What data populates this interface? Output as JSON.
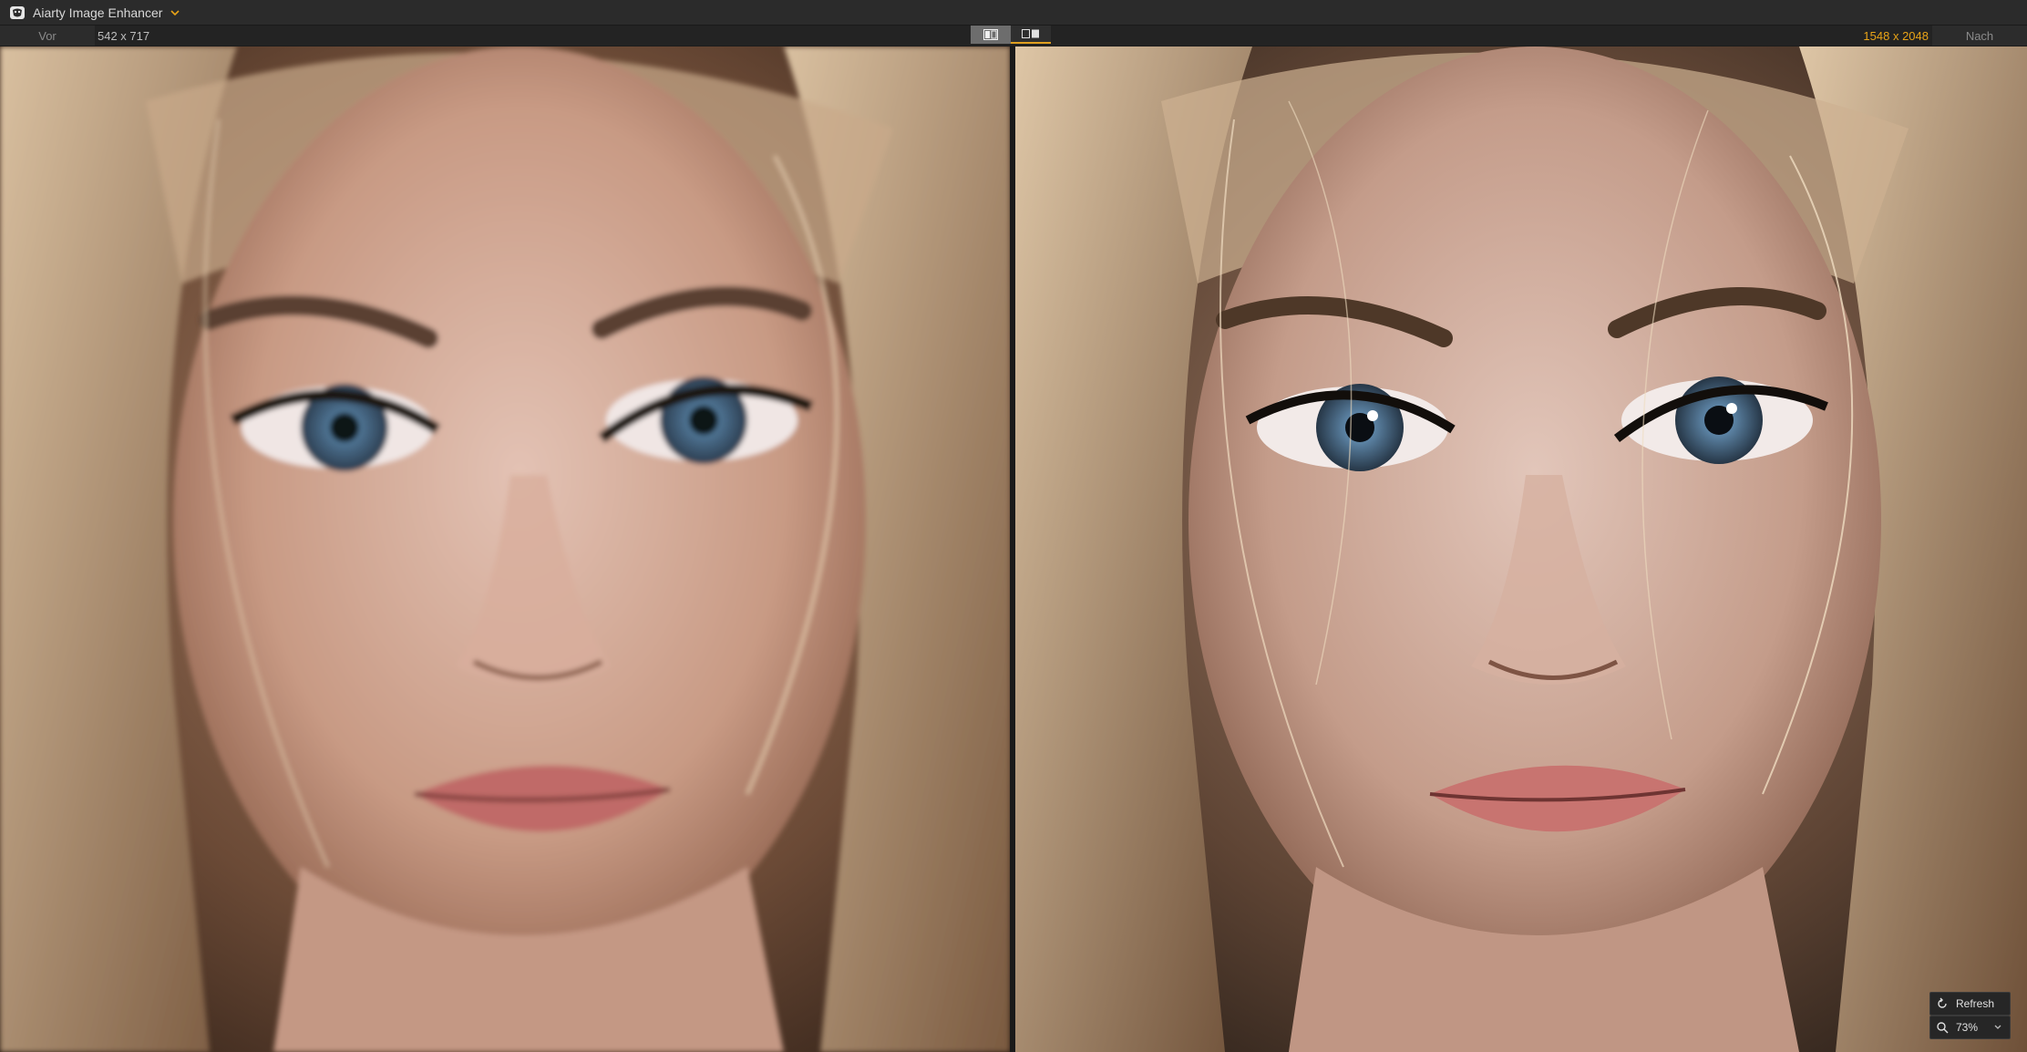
{
  "app": {
    "title": "Aiarty Image Enhancer",
    "logo_icon": "aiarty-logo-icon",
    "menu_icon": "chevron-down-icon"
  },
  "compare": {
    "before_label": "Vor",
    "before_resolution": "542 x 717",
    "after_label": "Nach",
    "after_resolution": "1548 x 2048",
    "after_resolution_color": "#e8a317",
    "view_modes": [
      "side-by-side",
      "split-compare"
    ],
    "active_view": "side-by-side"
  },
  "controls": {
    "refresh_label": "Refresh",
    "refresh_icon": "refresh-icon",
    "zoom_value": "73%",
    "zoom_icon": "zoom-icon",
    "zoom_dropdown_icon": "chevron-down-icon"
  },
  "colors": {
    "accent": "#e8a317",
    "background": "#1c1c1c"
  }
}
